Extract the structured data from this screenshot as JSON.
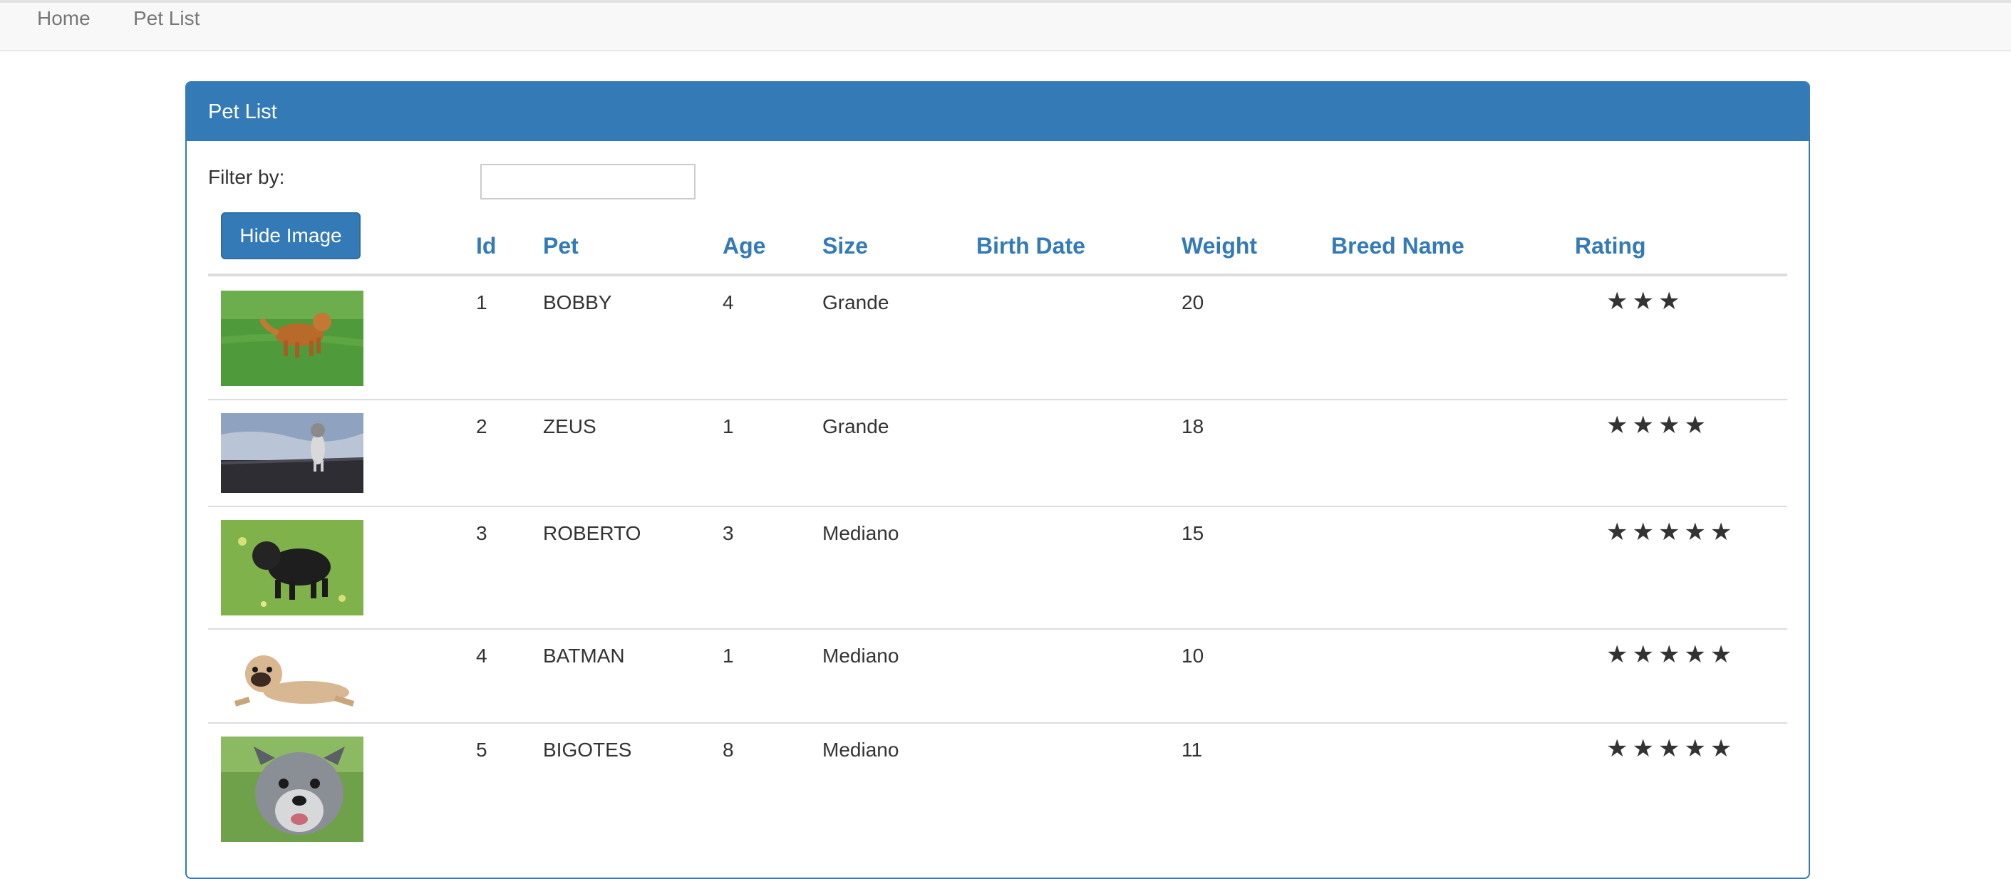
{
  "nav": {
    "home": "Home",
    "pet_list": "Pet List"
  },
  "panel": {
    "title": "Pet List"
  },
  "filter": {
    "label": "Filter by:",
    "value": ""
  },
  "hide_image_button": "Hide Image",
  "table": {
    "headers": {
      "id": "Id",
      "pet": "Pet",
      "age": "Age",
      "size": "Size",
      "birth_date": "Birth Date",
      "weight": "Weight",
      "breed_name": "Breed Name",
      "rating": "Rating"
    },
    "rows": [
      {
        "id": "1",
        "pet": "BOBBY",
        "age": "4",
        "size": "Grande",
        "birth_date": "",
        "weight": "20",
        "breed_name": "",
        "rating": 3,
        "stars": "★★★",
        "image": "golden-retriever-on-grass"
      },
      {
        "id": "2",
        "pet": "ZEUS",
        "age": "1",
        "size": "Grande",
        "birth_date": "",
        "weight": "18",
        "breed_name": "",
        "rating": 4,
        "stars": "★★★★",
        "image": "husky-on-beach"
      },
      {
        "id": "3",
        "pet": "ROBERTO",
        "age": "3",
        "size": "Mediano",
        "birth_date": "",
        "weight": "15",
        "breed_name": "",
        "rating": 5,
        "stars": "★★★★★",
        "image": "black-pug-on-grass"
      },
      {
        "id": "4",
        "pet": "BATMAN",
        "age": "1",
        "size": "Mediano",
        "birth_date": "",
        "weight": "10",
        "breed_name": "",
        "rating": 5,
        "stars": "★★★★★",
        "image": "fawn-pug-lying-down"
      },
      {
        "id": "5",
        "pet": "BIGOTES",
        "age": "8",
        "size": "Mediano",
        "birth_date": "",
        "weight": "11",
        "breed_name": "",
        "rating": 5,
        "stars": "★★★★★",
        "image": "schnauzer-portrait"
      }
    ]
  },
  "colors": {
    "primary": "#337ab7",
    "navbar_bg": "#f8f8f8",
    "text": "#333333",
    "muted": "#777777",
    "row_border": "#dddddd"
  }
}
